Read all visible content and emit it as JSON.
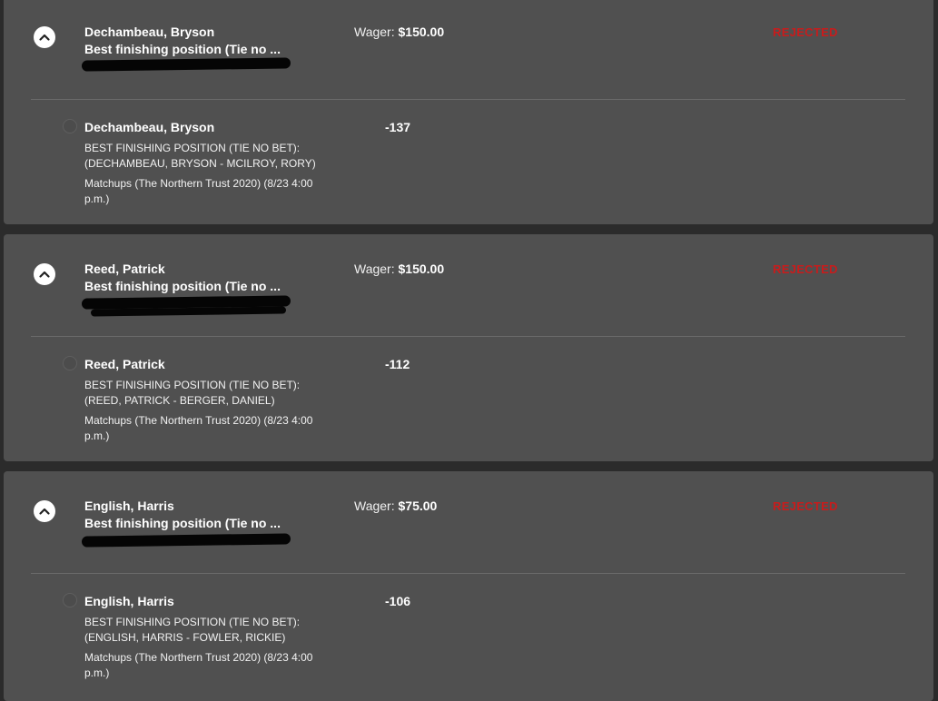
{
  "colors": {
    "card_bg": "#505050",
    "page_bg": "#2b2b2b",
    "status_rejected": "#c81c1c"
  },
  "bets": [
    {
      "name": "Dechambeau, Bryson",
      "market": "Best finishing position (Tie no ...",
      "wager_label": "Wager:",
      "wager_amount": "$150.00",
      "status": "REJECTED",
      "selection": {
        "name": "Dechambeau, Bryson",
        "odds": "-137",
        "description": "BEST FINISHING POSITION (TIE NO BET): (DECHAMBEAU, BRYSON - MCILROY, RORY)",
        "event": "Matchups (The Northern Trust 2020) (8/23 4:00 p.m.)"
      }
    },
    {
      "name": "Reed, Patrick",
      "market": "Best finishing position (Tie no ...",
      "wager_label": "Wager:",
      "wager_amount": "$150.00",
      "status": "REJECTED",
      "selection": {
        "name": "Reed, Patrick",
        "odds": "-112",
        "description": "BEST FINISHING POSITION (TIE NO BET): (REED, PATRICK - BERGER, DANIEL)",
        "event": "Matchups (The Northern Trust 2020) (8/23 4:00 p.m.)"
      }
    },
    {
      "name": "English, Harris",
      "market": "Best finishing position (Tie no ...",
      "wager_label": "Wager:",
      "wager_amount": "$75.00",
      "status": "REJECTED",
      "selection": {
        "name": "English, Harris",
        "odds": "-106",
        "description": "BEST FINISHING POSITION (TIE NO BET): (ENGLISH, HARRIS - FOWLER, RICKIE)",
        "event": "Matchups (The Northern Trust 2020) (8/23 4:00 p.m.)"
      }
    }
  ]
}
